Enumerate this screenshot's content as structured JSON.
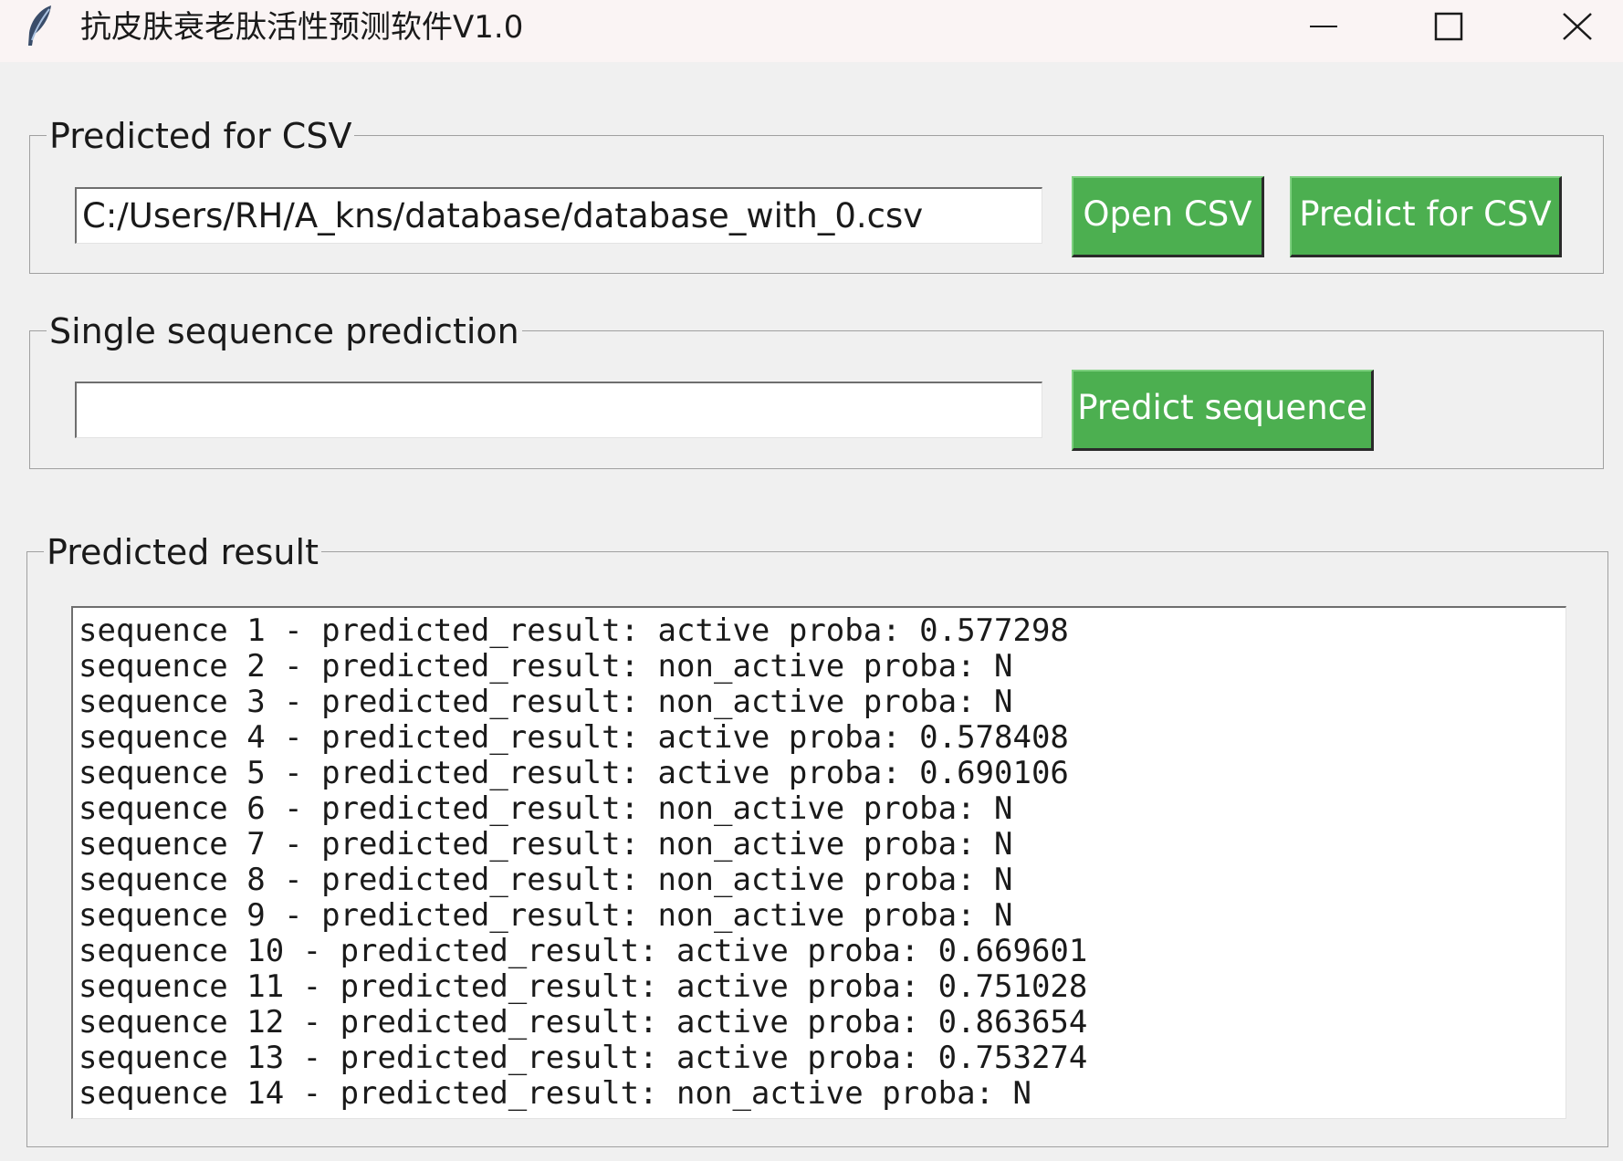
{
  "window": {
    "title": "抗皮肤衰老肽活性预测软件V1.0",
    "icons": {
      "app": "feather-icon",
      "minimize": "minimize-icon",
      "maximize": "maximize-icon",
      "close": "close-icon"
    }
  },
  "csv_group": {
    "legend": "Predicted for CSV",
    "path_value": "C:/Users/RH/A_kns/database/database_with_0.csv",
    "open_button": "Open CSV",
    "predict_button": "Predict for CSV"
  },
  "single_group": {
    "legend": "Single sequence prediction",
    "sequence_value": "",
    "predict_button": "Predict sequence"
  },
  "result_group": {
    "legend": "Predicted result",
    "lines": [
      "sequence 1 - predicted_result: active proba: 0.577298",
      "sequence 2 - predicted_result: non_active proba: N",
      "sequence 3 - predicted_result: non_active proba: N",
      "sequence 4 - predicted_result: active proba: 0.578408",
      "sequence 5 - predicted_result: active proba: 0.690106",
      "sequence 6 - predicted_result: non_active proba: N",
      "sequence 7 - predicted_result: non_active proba: N",
      "sequence 8 - predicted_result: non_active proba: N",
      "sequence 9 - predicted_result: non_active proba: N",
      "sequence 10 - predicted_result: active proba: 0.669601",
      "sequence 11 - predicted_result: active proba: 0.751028",
      "sequence 12 - predicted_result: active proba: 0.863654",
      "sequence 13 - predicted_result: active proba: 0.753274",
      "sequence 14 - predicted_result: non_active proba: N"
    ]
  },
  "colors": {
    "button_green": "#4caf50",
    "window_bg": "#f0f0f0",
    "titlebar_bg": "#faf4f4"
  }
}
